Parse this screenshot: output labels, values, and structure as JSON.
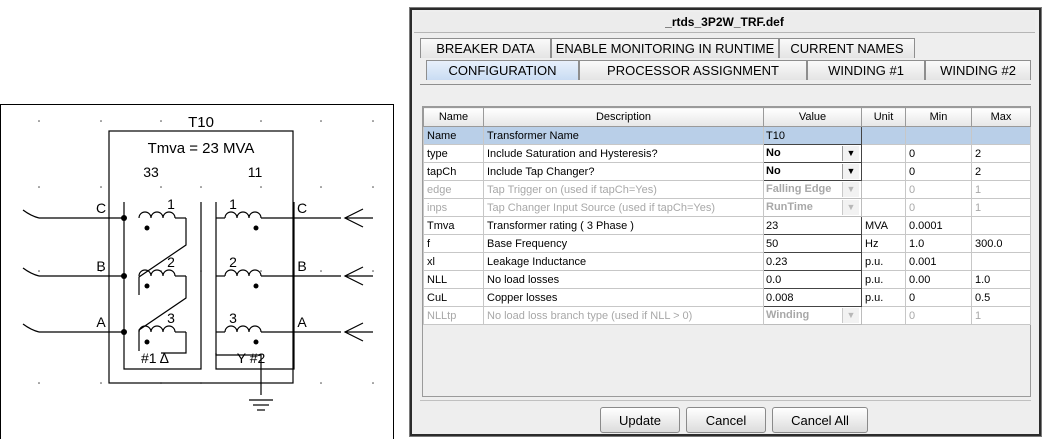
{
  "schematic": {
    "name": "T10",
    "rating": "Tmva = 23 MVA",
    "primary_kv": "33",
    "secondary_kv": "11",
    "primary_phases": [
      "C",
      "B",
      "A"
    ],
    "secondary_phases": [
      "C",
      "B",
      "A"
    ],
    "winding_numbers": [
      "1",
      "2",
      "3"
    ],
    "primary_label": "#1 Δ",
    "secondary_label": "Y #2"
  },
  "dialog": {
    "title": "_rtds_3P2W_TRF.def",
    "tabs_row1": [
      "BREAKER DATA",
      "ENABLE MONITORING IN RUNTIME",
      "CURRENT NAMES"
    ],
    "tabs_row2": [
      "CONFIGURATION",
      "PROCESSOR ASSIGNMENT",
      "WINDING #1",
      "WINDING #2"
    ],
    "selected_tab": "CONFIGURATION",
    "columns": [
      "Name",
      "Description",
      "Value",
      "Unit",
      "Min",
      "Max"
    ],
    "rows": [
      {
        "name": "Name",
        "description": "Transformer Name",
        "value": "T10",
        "unit": "",
        "min": "",
        "max": "",
        "kind": "text",
        "state": "selected"
      },
      {
        "name": "type",
        "description": "Include Saturation and Hysteresis?",
        "value": "No",
        "unit": "",
        "min": "0",
        "max": "2",
        "kind": "dropdown",
        "state": "normal"
      },
      {
        "name": "tapCh",
        "description": "Include Tap Changer?",
        "value": "No",
        "unit": "",
        "min": "0",
        "max": "2",
        "kind": "dropdown",
        "state": "normal"
      },
      {
        "name": "edge",
        "description": "Tap Trigger on (used if tapCh=Yes)",
        "value": "Falling Edge",
        "unit": "",
        "min": "0",
        "max": "1",
        "kind": "dropdown",
        "state": "disabled"
      },
      {
        "name": "inps",
        "description": "Tap Changer Input Source (used if tapCh=Yes)",
        "value": "RunTime",
        "unit": "",
        "min": "0",
        "max": "1",
        "kind": "dropdown",
        "state": "disabled"
      },
      {
        "name": "Tmva",
        "description": "Transformer rating ( 3 Phase )",
        "value": "23",
        "unit": "MVA",
        "min": "0.0001",
        "max": "",
        "kind": "text",
        "state": "normal"
      },
      {
        "name": "f",
        "description": "Base Frequency",
        "value": "50",
        "unit": "Hz",
        "min": "1.0",
        "max": "300.0",
        "kind": "text",
        "state": "normal"
      },
      {
        "name": "xl",
        "description": "Leakage Inductance",
        "value": "0.23",
        "unit": "p.u.",
        "min": "0.001",
        "max": "",
        "kind": "text",
        "state": "normal"
      },
      {
        "name": "NLL",
        "description": "No load losses",
        "value": "0.0",
        "unit": "p.u.",
        "min": "0.00",
        "max": "1.0",
        "kind": "text",
        "state": "normal"
      },
      {
        "name": "CuL",
        "description": "Copper losses",
        "value": "0.008",
        "unit": "p.u.",
        "min": "0",
        "max": "0.5",
        "kind": "text",
        "state": "normal"
      },
      {
        "name": "NLLtp",
        "description": "No load loss branch type (used if NLL > 0)",
        "value": "Winding",
        "unit": "",
        "min": "0",
        "max": "1",
        "kind": "dropdown",
        "state": "disabled"
      }
    ],
    "buttons": {
      "update": "Update",
      "cancel": "Cancel",
      "cancel_all": "Cancel All"
    },
    "dropdown_arrow": "▼"
  }
}
